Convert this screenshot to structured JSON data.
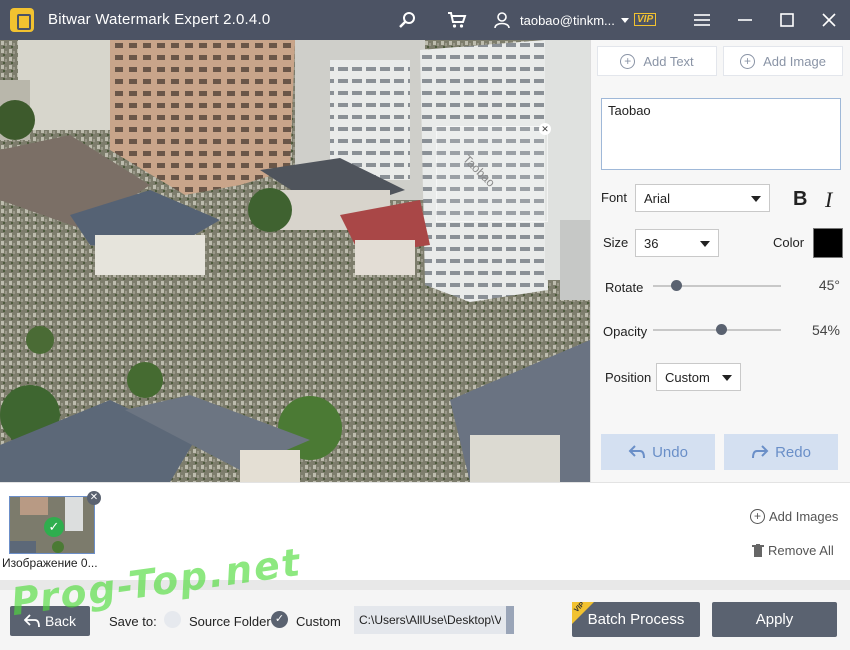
{
  "app": {
    "title": "Bitwar Watermark Expert  2.0.4.0",
    "user_email": "taobao@tinkm...",
    "vip_label": "VIP"
  },
  "titlebar_icons": [
    "search-icon",
    "cart-icon",
    "user-icon",
    "menu-icon",
    "minimize-icon",
    "maximize-icon",
    "close-icon"
  ],
  "canvas": {
    "watermark_text": "Taobao"
  },
  "panel": {
    "add_text_label": "Add Text",
    "add_image_label": "Add Image",
    "text_value": "Taobao",
    "font_label": "Font",
    "font_value": "Arial",
    "bold_label": "B",
    "italic_label": "I",
    "size_label": "Size",
    "size_value": "36",
    "color_label": "Color",
    "color_value": "#000000",
    "rotate_label": "Rotate",
    "rotate_value": "45°",
    "rotate_fraction": 0.15,
    "opacity_label": "Opacity",
    "opacity_value": "54%",
    "opacity_fraction": 0.54,
    "position_label": "Position",
    "position_value": "Custom",
    "undo_label": "Undo",
    "redo_label": "Redo"
  },
  "files": {
    "items": [
      {
        "name": "Изображение 0..."
      }
    ],
    "add_images_label": "Add Images",
    "remove_all_label": "Remove All"
  },
  "bottom": {
    "back_label": "Back",
    "save_to_label": "Save to:",
    "source_folder_label": "Source Folder",
    "custom_label": "Custom",
    "path_value": "C:\\Users\\AllUse\\Desktop\\V",
    "batch_label": "Batch Process",
    "batch_vip": "VIP",
    "apply_label": "Apply"
  },
  "overlay": {
    "site_watermark": "Prog-Top.net"
  },
  "colors": {
    "titlebar": "#4c5364",
    "accent_dark": "#5a6270",
    "vip": "#f2c230",
    "undo_bg": "#d4e0f1"
  }
}
